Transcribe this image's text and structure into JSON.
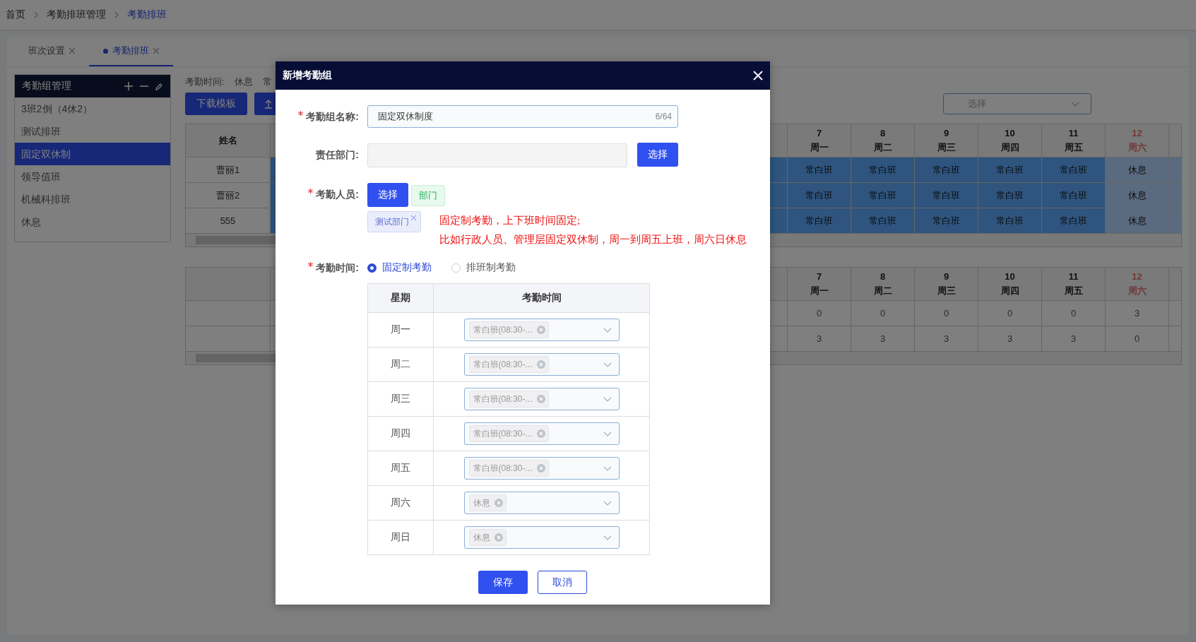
{
  "breadcrumb": [
    {
      "label": "首页",
      "current": false
    },
    {
      "label": "考勤排班管理",
      "current": false
    },
    {
      "label": "考勤排班",
      "current": true
    }
  ],
  "tabs": [
    {
      "label": "班次设置",
      "selected": false
    },
    {
      "label": "考勤排班",
      "selected": true
    }
  ],
  "sidebar": {
    "title": "考勤组管理",
    "items": [
      {
        "label": "3班2倒（4休2）",
        "selected": false
      },
      {
        "label": "测试排班",
        "selected": false
      },
      {
        "label": "固定双休制",
        "selected": true
      },
      {
        "label": "领导值班",
        "selected": false
      },
      {
        "label": "机械科排班",
        "selected": false
      },
      {
        "label": "休息",
        "selected": false
      }
    ]
  },
  "legend": {
    "label": "考勤时间:",
    "items": [
      "休息",
      "常"
    ]
  },
  "toolbar": {
    "buttons": [
      "下载模板"
    ],
    "select_placeholder": "选择"
  },
  "schedule_table": {
    "name_header": "姓名",
    "columns": [
      {
        "day": "7",
        "weekday": "周一",
        "weekend": false
      },
      {
        "day": "8",
        "weekday": "周二",
        "weekend": false
      },
      {
        "day": "9",
        "weekday": "周三",
        "weekend": false
      },
      {
        "day": "10",
        "weekday": "周四",
        "weekend": false
      },
      {
        "day": "11",
        "weekday": "周五",
        "weekend": false
      },
      {
        "day": "12",
        "weekday": "周六",
        "weekend": true
      }
    ],
    "rows": [
      {
        "name": "曹丽1",
        "cells": [
          {
            "text": "常白班",
            "kind": "work"
          },
          {
            "text": "常白班",
            "kind": "work"
          },
          {
            "text": "常白班",
            "kind": "work"
          },
          {
            "text": "常白班",
            "kind": "work"
          },
          {
            "text": "常白班",
            "kind": "work"
          },
          {
            "text": "休息",
            "kind": "rest"
          }
        ]
      },
      {
        "name": "曹丽2",
        "cells": [
          {
            "text": "常白班",
            "kind": "work"
          },
          {
            "text": "常白班",
            "kind": "work"
          },
          {
            "text": "常白班",
            "kind": "work"
          },
          {
            "text": "常白班",
            "kind": "work"
          },
          {
            "text": "常白班",
            "kind": "work"
          },
          {
            "text": "休息",
            "kind": "rest"
          }
        ]
      },
      {
        "name": "555",
        "cells": [
          {
            "text": "常白班",
            "kind": "work"
          },
          {
            "text": "常白班",
            "kind": "work"
          },
          {
            "text": "常白班",
            "kind": "work"
          },
          {
            "text": "常白班",
            "kind": "work"
          },
          {
            "text": "常白班",
            "kind": "work"
          },
          {
            "text": "休息",
            "kind": "rest"
          }
        ]
      }
    ]
  },
  "summary_table": {
    "columns": [
      {
        "day": "7",
        "weekday": "周一",
        "weekend": false
      },
      {
        "day": "8",
        "weekday": "周二",
        "weekend": false
      },
      {
        "day": "9",
        "weekday": "周三",
        "weekend": false
      },
      {
        "day": "10",
        "weekday": "周四",
        "weekend": false
      },
      {
        "day": "11",
        "weekday": "周五",
        "weekend": false
      },
      {
        "day": "12",
        "weekday": "周六",
        "weekend": true
      }
    ],
    "rows": [
      {
        "values": [
          "0",
          "0",
          "0",
          "0",
          "0",
          "3"
        ]
      },
      {
        "values": [
          "3",
          "3",
          "3",
          "3",
          "3",
          "0"
        ]
      }
    ]
  },
  "dialog": {
    "title": "新增考勤组",
    "name_field": {
      "label": "考勤组名称:",
      "required": true,
      "value": "固定双休制度",
      "counter": "6/64"
    },
    "dept_field": {
      "label": "责任部门:",
      "required": false,
      "button": "选择"
    },
    "staff_field": {
      "label": "考勤人员:",
      "required": true,
      "button": "选择",
      "type_tag": "部门",
      "tags": [
        "测试部门"
      ],
      "note": [
        "固定制考勤，上下班时间固定;",
        "比如行政人员、管理层固定双休制，周一到周五上班，周六日休息"
      ]
    },
    "time_field": {
      "label": "考勤时间:",
      "required": true,
      "options": [
        {
          "label": "固定制考勤",
          "selected": true
        },
        {
          "label": "排班制考勤",
          "selected": false
        }
      ]
    },
    "week_table": {
      "columns": [
        "星期",
        "考勤时间"
      ],
      "rows": [
        {
          "day": "周一",
          "shift": "常白班(08:30-..."
        },
        {
          "day": "周二",
          "shift": "常白班(08:30-..."
        },
        {
          "day": "周三",
          "shift": "常白班(08:30-..."
        },
        {
          "day": "周四",
          "shift": "常白班(08:30-..."
        },
        {
          "day": "周五",
          "shift": "常白班(08:30-..."
        },
        {
          "day": "周六",
          "shift": "休息"
        },
        {
          "day": "周日",
          "shift": "休息"
        }
      ]
    },
    "buttons": [
      {
        "label": "保存",
        "kind": "primary"
      },
      {
        "label": "取消",
        "kind": "secondary"
      }
    ]
  }
}
